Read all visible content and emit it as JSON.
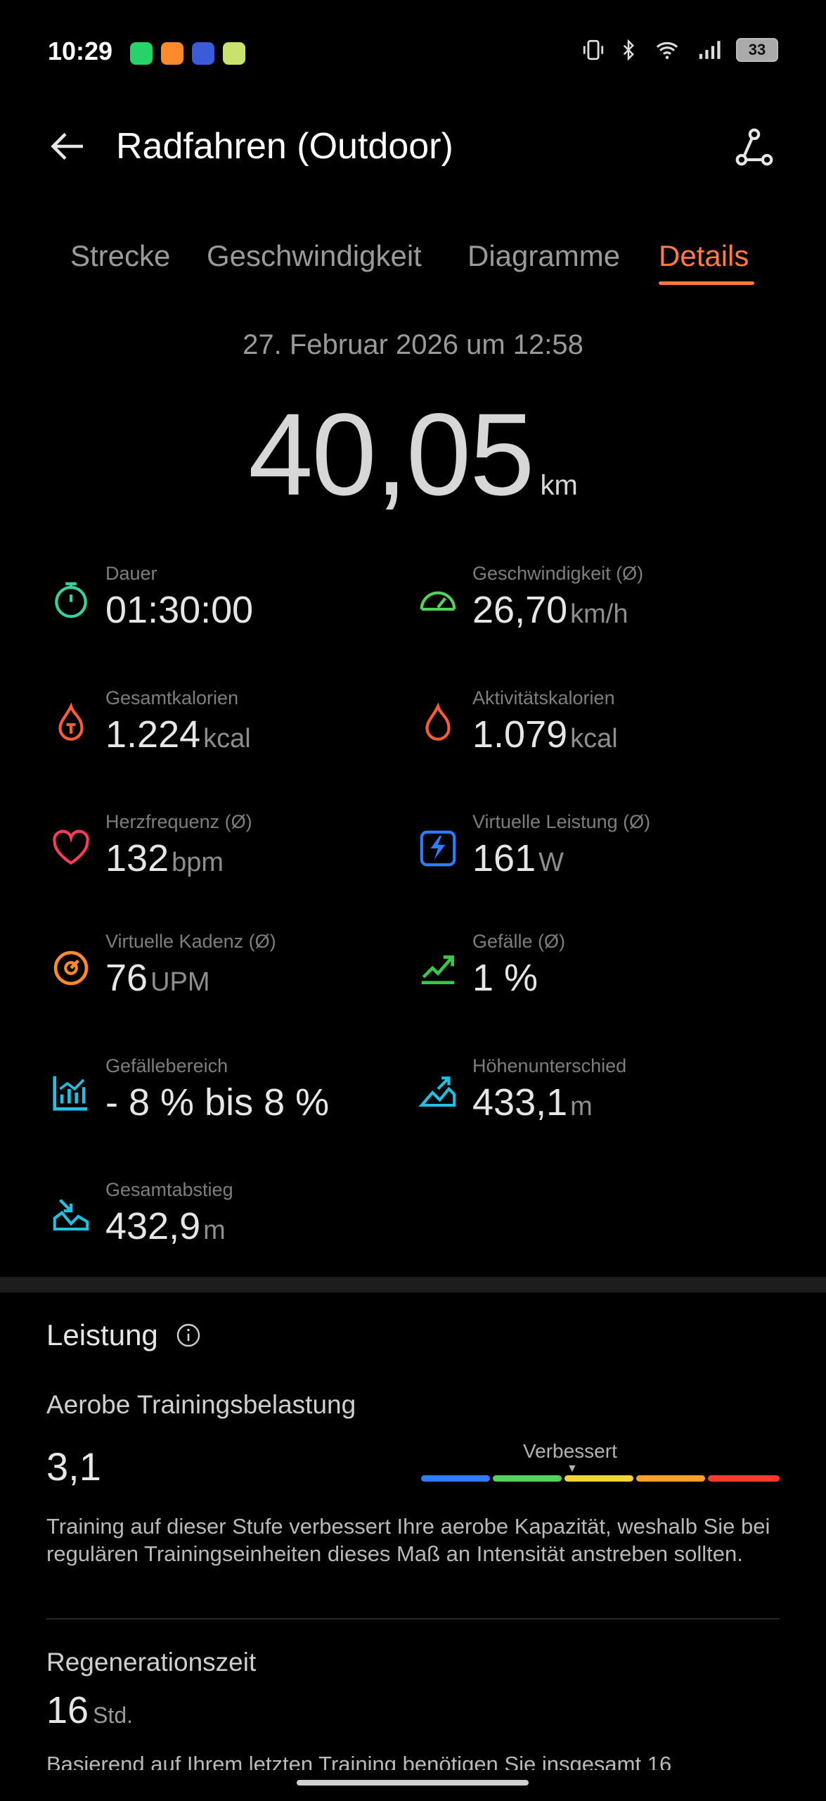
{
  "status": {
    "time": "10:29",
    "battery": "33",
    "app_icons": [
      {
        "name": "whatsapp-icon",
        "color": "#25d366"
      },
      {
        "name": "app-orange-icon",
        "color": "#ff8a2b"
      },
      {
        "name": "pokeball-icon",
        "color": "#3b5bdb"
      },
      {
        "name": "app-green-icon",
        "color": "#c7e36b"
      }
    ]
  },
  "header": {
    "title": "Radfahren (Outdoor)"
  },
  "tabs": [
    "Strecke",
    "Geschwindigkeit",
    "Diagramme",
    "Details"
  ],
  "active_tab": "Details",
  "summary": {
    "date": "27. Februar 2026 um 12:58",
    "distance": "40,05",
    "distance_unit": "km"
  },
  "metrics": [
    {
      "label": "Dauer",
      "value": "01:30:00",
      "unit": "",
      "icon": "stopwatch-icon",
      "color": "#3ad1a0"
    },
    {
      "label": "Geschwindigkeit (Ø)",
      "value": "26,70",
      "unit": "km/h",
      "icon": "speedometer-icon",
      "color": "#52d35c"
    },
    {
      "label": "Gesamtkalorien",
      "value": "1.224",
      "unit": "kcal",
      "icon": "total-calories-icon",
      "color": "#ff5a3c"
    },
    {
      "label": "Aktivitätskalorien",
      "value": "1.079",
      "unit": "kcal",
      "icon": "flame-icon",
      "color": "#ff5a3c"
    },
    {
      "label": "Herzfrequenz (Ø)",
      "value": "132",
      "unit": "bpm",
      "icon": "heart-icon",
      "color": "#ff3b5c"
    },
    {
      "label": "Virtuelle Leistung (Ø)",
      "value": "161",
      "unit": "W",
      "icon": "power-icon",
      "color": "#2f7dff"
    },
    {
      "label": "Virtuelle Kadenz (Ø)",
      "value": "76",
      "unit": "UPM",
      "icon": "cadence-icon",
      "color": "#ff8a2b"
    },
    {
      "label": "Gefälle (Ø)",
      "value": "1 %",
      "unit": "",
      "icon": "slope-icon",
      "color": "#36c84a"
    },
    {
      "label": "Gefällebereich",
      "value": "- 8 % bis 8 %",
      "unit": "",
      "icon": "slope-range-icon",
      "color": "#22c0e0"
    },
    {
      "label": "Höhenunterschied",
      "value": "433,1",
      "unit": "m",
      "icon": "ascent-icon",
      "color": "#22c0e0"
    },
    {
      "label": "Gesamtabstieg",
      "value": "432,9",
      "unit": "m",
      "icon": "descent-icon",
      "color": "#22c0e0"
    }
  ],
  "performance": {
    "title": "Leistung",
    "aerobic": {
      "title": "Aerobe Trainingsbelastung",
      "value": "3,1",
      "level_label": "Verbessert",
      "scale_colors": [
        "#2f7dff",
        "#52d35c",
        "#f2d33a",
        "#ff9d2e",
        "#ff3b30"
      ],
      "description": "Training auf dieser Stufe verbessert Ihre aerobe Kapazität, weshalb Sie bei regulären Trainingseinheiten dieses Maß an Intensität anstreben sollten."
    },
    "regeneration": {
      "title": "Regenerationszeit",
      "value": "16",
      "unit": "Std.",
      "description": "Basierend auf Ihrem letzten Training benötigen Sie insgesamt 16"
    }
  }
}
